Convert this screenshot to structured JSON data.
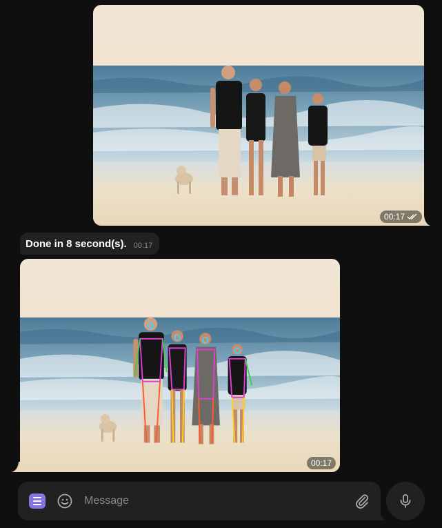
{
  "messages": {
    "outgoing_photo": {
      "time": "00:17",
      "status": "read-double-check-icon"
    },
    "incoming_text": {
      "text": "Done in 8 second(s).",
      "time": "00:17"
    },
    "incoming_photo": {
      "time": "00:17"
    }
  },
  "composer": {
    "placeholder": "Message",
    "menu_icon": "menu-icon",
    "emoji_icon": "smile-icon",
    "attach_icon": "paperclip-icon",
    "mic_icon": "microphone-icon"
  },
  "colors": {
    "background": "#0f0f0f",
    "bubble_incoming": "#212121",
    "accent": "#8774e1",
    "secondary_text": "#8a8a8a"
  }
}
